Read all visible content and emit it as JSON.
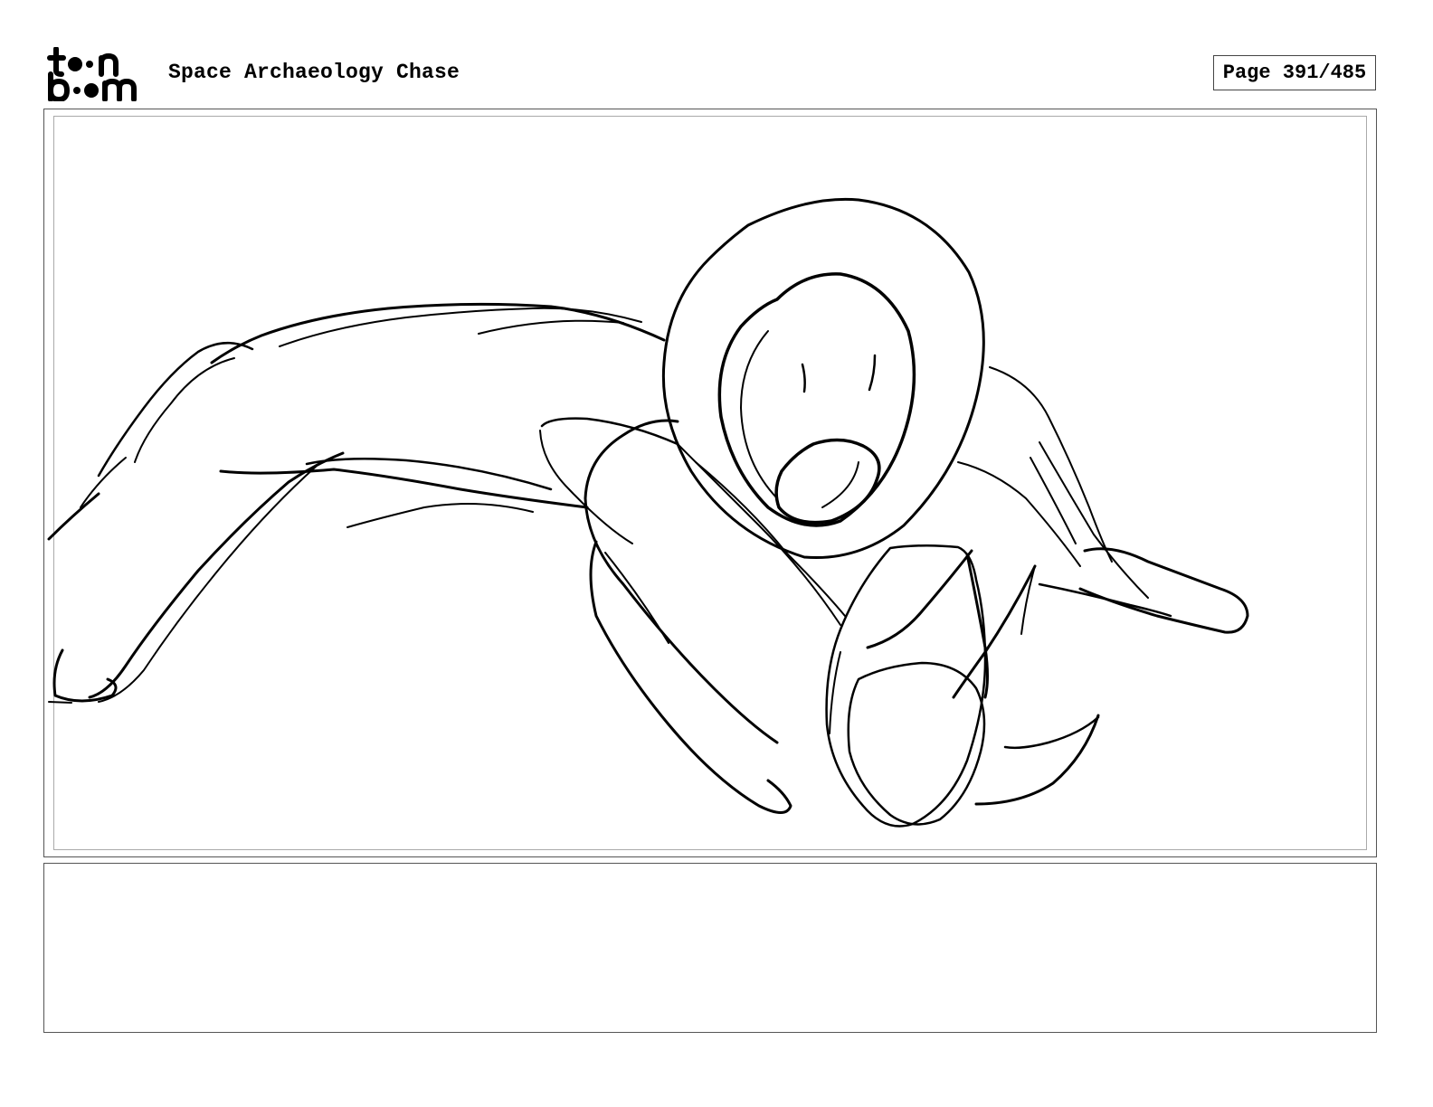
{
  "header": {
    "logo_text_line1": "toon",
    "logo_text_line2": "boom",
    "project_title": "Space Archaeology Chase",
    "page_label": "Page 391/485"
  },
  "panel": {
    "sketch_subject": "astronaut-figure-sketch"
  },
  "notes": {
    "text": ""
  },
  "colors": {
    "ink": "#000000",
    "frame": "#555555",
    "inner_frame": "#aaaaaa",
    "background": "#ffffff"
  }
}
